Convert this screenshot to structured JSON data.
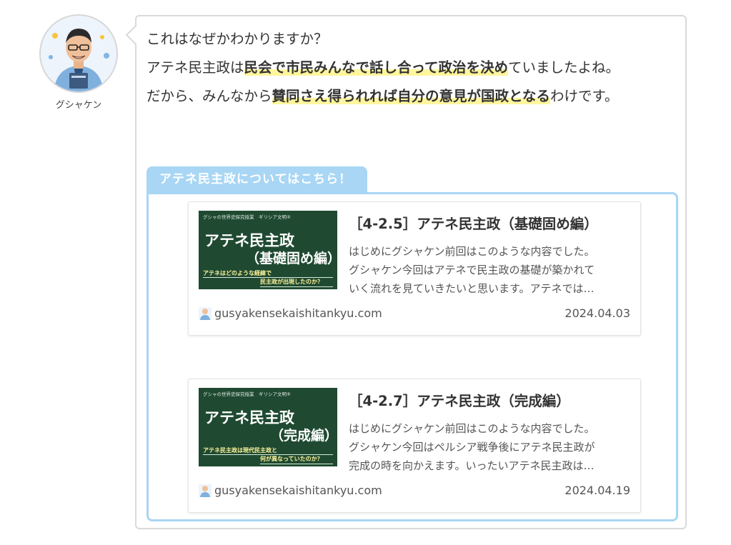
{
  "author": {
    "name": "グシャケン"
  },
  "bubble": {
    "lines": [
      {
        "plain1": "これはなぜかわかりますか？"
      },
      {
        "plain1": "アテネ民主政は",
        "mark": "民会で市民みんなで話し合って政治を決め",
        "plain2": "ていましたよね。"
      },
      {
        "plain1": "だから、みんなから",
        "mark": "賛同さえ得られれば自分の意見が国政となる",
        "plain2": "わけです。"
      }
    ]
  },
  "related": {
    "label": "アテネ民主政についてはこちら！",
    "cards": [
      {
        "thumb_top": "グシャの世界史探究授業　ギリシア文明④",
        "thumb_main": "アテネ民主政",
        "thumb_sub": "（基礎固め編）",
        "thumb_note1": "アテネはどのような経緯で",
        "thumb_note2": "民主政が出現したのか？",
        "title": "［4-2.5］アテネ民主政（基礎固め編）",
        "excerpt1": "はじめにグシャケン前回はこのような内容でした。",
        "excerpt2": "グシャケン今回はアテネで民主政の基礎が築かれて",
        "excerpt3": "いく流れを見ていきたいと思います。アテネでは…",
        "site": "gusyakensekaishitankyu.com",
        "date": "2024.04.03"
      },
      {
        "thumb_top": "グシャの世界史探究授業　ギリシア文明⑥",
        "thumb_main": "アテネ民主政",
        "thumb_sub": "（完成編）",
        "thumb_note1": "アテネ民主政は現代民主政と",
        "thumb_note2": "何が異なっていたのか？",
        "title": "［4-2.7］アテネ民主政（完成編）",
        "excerpt1": "はじめにグシャケン前回はこのような内容でした。",
        "excerpt2": "グシャケン今回はペルシア戦争後にアテネ民主政が",
        "excerpt3": "完成の時を向かえます。いったいアテネ民主政は…",
        "site": "gusyakensekaishitankyu.com",
        "date": "2024.04.19"
      }
    ]
  },
  "colors": {
    "label_bg": "#a8d6f4",
    "highlight": "#fff59d",
    "thumb_bg": "#1f4a31"
  }
}
